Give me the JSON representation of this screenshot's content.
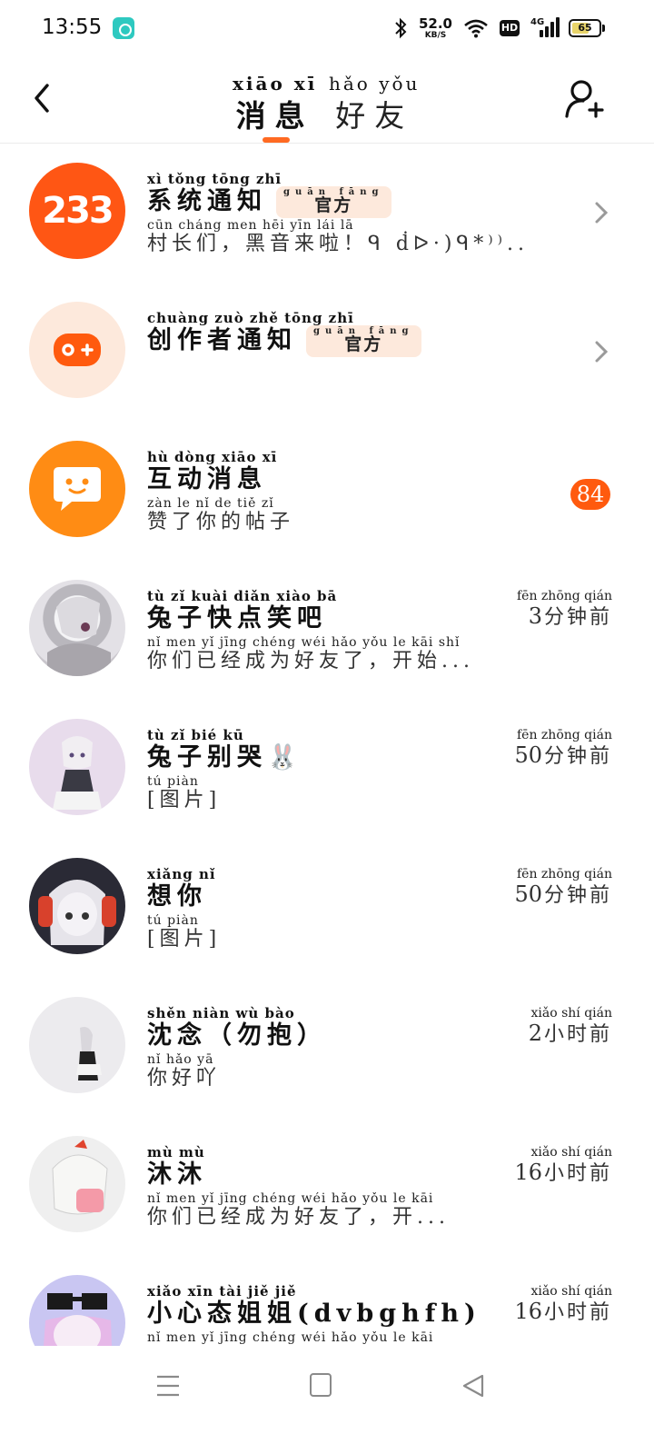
{
  "status_bar": {
    "time": "13:55",
    "net_speed": "52.0",
    "net_unit": "KB/S",
    "hd_label": "HD",
    "signal_label": "4G",
    "battery": "65"
  },
  "header": {
    "tabs": [
      {
        "pinyin": "xiāo xī",
        "label": "消息",
        "active": true
      },
      {
        "pinyin": "hǎo yǒu",
        "label": "好友",
        "active": false
      }
    ],
    "accent_color": "#ff6a22"
  },
  "messages": [
    {
      "title_pinyin": "xì tǒng tōng zhī",
      "title": "系统通知",
      "official": true,
      "official_pinyin": "guān fāng",
      "official_label": "官方",
      "subtitle_pinyin": "cūn cháng men      hēi  yīn  lái  lā",
      "subtitle": "村长们，黑音来啦！ᑫ ḋᐅ·)ᑫ*⁾⁾...",
      "avatar": "logo-233",
      "avatar_text": "233",
      "has_chevron": true
    },
    {
      "title_pinyin": "chuàng zuò zhě tōng zhī",
      "title": "创作者通知",
      "official": true,
      "official_pinyin": "guān fāng",
      "official_label": "官方",
      "avatar": "gamepad-icon",
      "has_chevron": true
    },
    {
      "title_pinyin": "hù dòng xiāo xī",
      "title": "互动消息",
      "subtitle_pinyin": "zàn  le  nǐ  de  tiě  zǐ",
      "subtitle": "赞了你的帖子",
      "avatar": "chat-bubble-icon",
      "unread_count": "84"
    },
    {
      "title_pinyin": "tù  zǐ  kuài diǎn xiào  bā",
      "title": "兔子快点笑吧",
      "subtitle_pinyin": "nǐ  men  yǐ  jīng chéng wéi hǎo yǒu  le        kāi  shǐ",
      "subtitle": "你们已经成为好友了，开始...",
      "time_pinyin": "fēn zhōng qián",
      "time_num": "3",
      "time_unit": "分钟前",
      "avatar": "user-avatar"
    },
    {
      "title_pinyin": "tù  zǐ  bié  kū",
      "title": "兔子别哭🐰",
      "subtitle_pinyin": "tú   piàn",
      "subtitle": "[图片]",
      "time_pinyin": "fēn zhōng qián",
      "time_num": "50",
      "time_unit": "分钟前",
      "avatar": "user-avatar"
    },
    {
      "title_pinyin": "xiǎng  nǐ",
      "title": "想你",
      "subtitle_pinyin": "tú   piàn",
      "subtitle": "[图片]",
      "time_pinyin": "fēn zhōng qián",
      "time_num": "50",
      "time_unit": "分钟前",
      "avatar": "user-avatar"
    },
    {
      "title_pinyin": "shěn niàn     wù  bào",
      "title": "沈念（勿抱）",
      "subtitle_pinyin": "nǐ  hǎo  yā",
      "subtitle": "你好吖",
      "time_pinyin": "xiǎo shí qián",
      "time_num": "2",
      "time_unit": "小时前",
      "avatar": "user-avatar"
    },
    {
      "title_pinyin": "mù  mù",
      "title": "沐沐",
      "subtitle_pinyin": "nǐ  men  yǐ  jīng chéng wéi hǎo yǒu  le        kāi",
      "subtitle": "你们已经成为好友了，开...",
      "time_pinyin": "xiǎo shí qián",
      "time_num": "16",
      "time_unit": "小时前",
      "avatar": "user-avatar"
    },
    {
      "title_pinyin": "xiǎo xīn  tài  jiě  jiě",
      "title": "小心态姐姐(dvbghfh)",
      "subtitle_pinyin": "nǐ  men  yǐ  jīng chéng wéi hǎo yǒu  le        kāi",
      "subtitle": "",
      "time_pinyin": "xiǎo shí qián",
      "time_num": "16",
      "time_unit": "小时前",
      "avatar": "user-avatar"
    }
  ]
}
